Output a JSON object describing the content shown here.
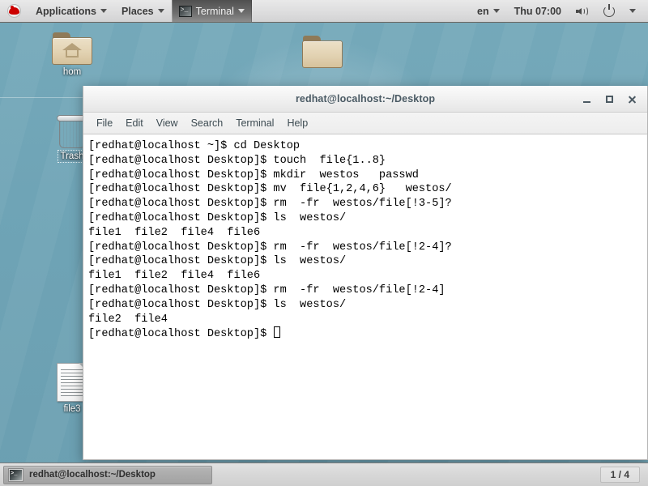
{
  "top_panel": {
    "logo_icon": "redhat-logo-icon",
    "applications_label": "Applications",
    "places_label": "Places",
    "terminal_label": "Terminal",
    "language_label": "en",
    "clock_label": "Thu 07:00",
    "volume_icon": "volume-icon",
    "power_icon": "power-icon",
    "caret_icon": "chevron-down-icon"
  },
  "desktop": {
    "icons": [
      {
        "name": "home",
        "label": "hom",
        "type": "home-folder"
      },
      {
        "name": "trash",
        "label": "Trash",
        "type": "trash"
      },
      {
        "name": "file3",
        "label": "file3",
        "type": "document"
      },
      {
        "name": "folder",
        "label": "",
        "type": "folder"
      }
    ]
  },
  "terminal": {
    "title": "redhat@localhost:~/Desktop",
    "menus": [
      "File",
      "Edit",
      "View",
      "Search",
      "Terminal",
      "Help"
    ],
    "window_buttons": {
      "minimize": "minimize-button",
      "maximize": "maximize-button",
      "close": "close-button"
    },
    "lines": [
      "[redhat@localhost ~]$ cd Desktop",
      "[redhat@localhost Desktop]$ touch  file{1..8}",
      "[redhat@localhost Desktop]$ mkdir  westos   passwd",
      "[redhat@localhost Desktop]$ mv  file{1,2,4,6}   westos/",
      "[redhat@localhost Desktop]$ rm  -fr  westos/file[!3-5]?",
      "[redhat@localhost Desktop]$ ls  westos/",
      "file1  file2  file4  file6",
      "[redhat@localhost Desktop]$ rm  -fr  westos/file[!2-4]?",
      "[redhat@localhost Desktop]$ ls  westos/",
      "file1  file2  file4  file6",
      "[redhat@localhost Desktop]$ rm  -fr  westos/file[!2-4]",
      "[redhat@localhost Desktop]$ ls  westos/",
      "file2  file4",
      "[redhat@localhost Desktop]$ "
    ]
  },
  "bottom_panel": {
    "task_label": "redhat@localhost:~/Desktop",
    "task_icon": "terminal-icon",
    "workspace_label": "1 / 4"
  },
  "colors": {
    "desktop_bg": "#6fa4b6",
    "panel_bg": "#dedede",
    "terminal_bg": "#ffffff",
    "terminal_fg": "#000000",
    "title_fg": "#4a5a64",
    "redhat_red": "#cc0000"
  }
}
